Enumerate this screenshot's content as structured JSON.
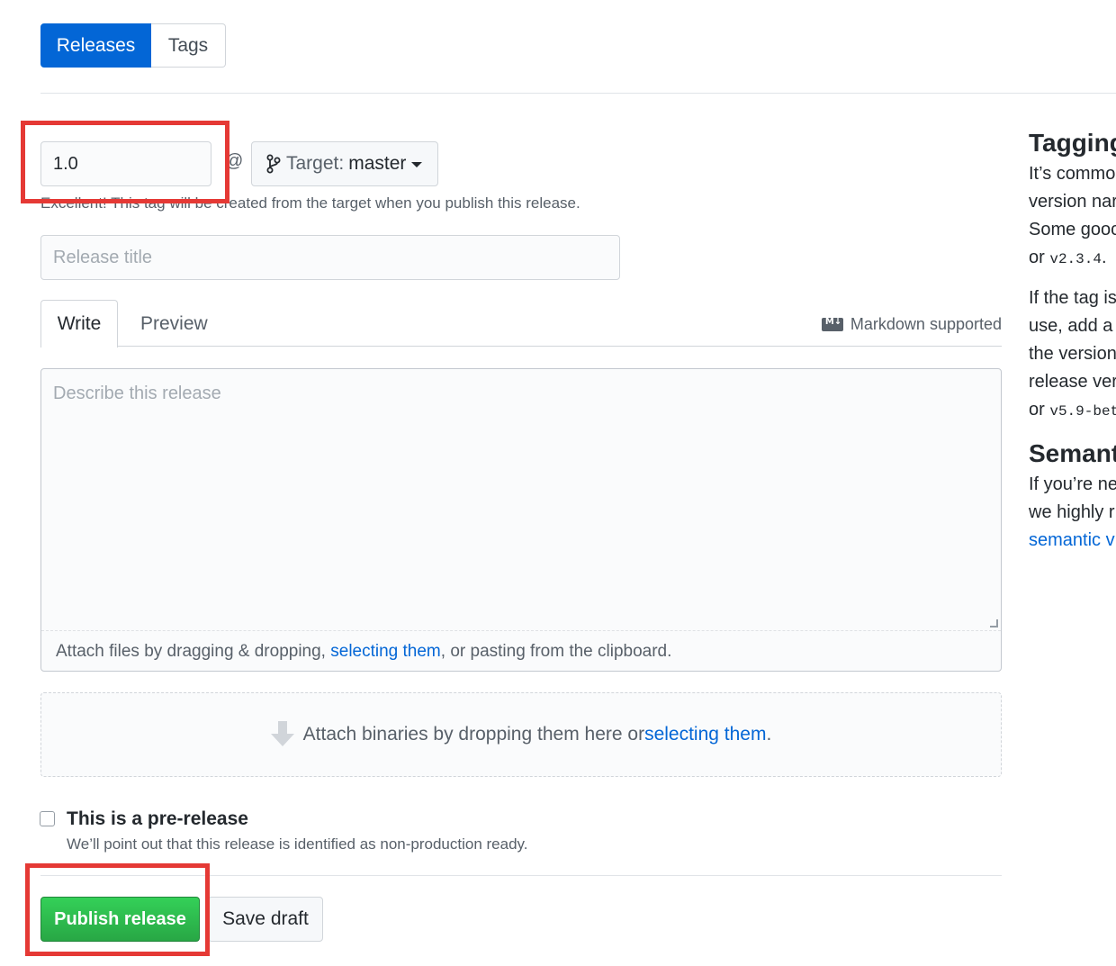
{
  "tabs": {
    "releases": "Releases",
    "tags": "Tags"
  },
  "tag": {
    "value": "1.0",
    "at": "@",
    "target_label": "Target:",
    "target_value": "master",
    "hint": "Excellent! This tag will be created from the target when you publish this release."
  },
  "release_title": {
    "placeholder": "Release title"
  },
  "editor": {
    "write_tab": "Write",
    "preview_tab": "Preview",
    "markdown_icon": "M↓",
    "markdown_note": "Markdown supported",
    "placeholder": "Describe this release",
    "attach_prefix": "Attach files by dragging & dropping, ",
    "attach_link": "selecting them",
    "attach_suffix": ", or pasting from the clipboard."
  },
  "binaries": {
    "text": "Attach binaries by dropping them here or ",
    "link": "selecting them",
    "suffix": "."
  },
  "prerelease": {
    "label": "This is a pre-release",
    "hint": "We’ll point out that this release is identified as non-production ready."
  },
  "buttons": {
    "publish": "Publish release",
    "save_draft": "Save draft"
  },
  "sidebar": {
    "tagging_title": "Tagging",
    "p1_l1": "It’s commo",
    "p1_l2": "version nar",
    "p1_l3": "Some gooc",
    "p1_l4_pre": "or ",
    "p1_l4_code": "v2.3.4",
    "p1_l4_post": ".",
    "p2_l1": "If the tag is",
    "p2_l2": "use, add a",
    "p2_l3": "the version",
    "p2_l4": "release ver",
    "p2_l5_pre": "or ",
    "p2_l5_code": "v5.9-bet",
    "semantic_title": "Semant",
    "p3_l1": "If you’re ne",
    "p3_l2": "we highly r",
    "p3_link": "semantic v"
  },
  "colors": {
    "accent": "#0366d6",
    "publish_green": "#2cbe4e",
    "highlight_red": "#e53935"
  }
}
